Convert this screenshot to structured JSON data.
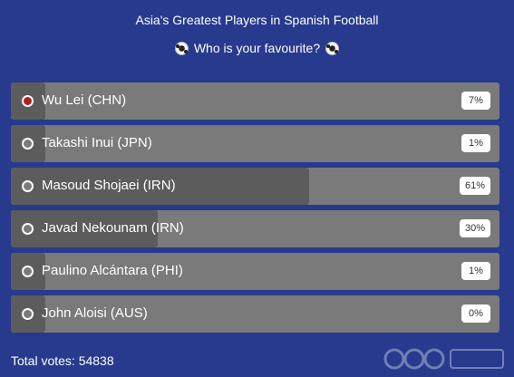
{
  "poll": {
    "title": "Asia's Greatest Players in Spanish Football",
    "subtitle": "Who is your favourite?",
    "options": [
      {
        "label": "Wu Lei (CHN)",
        "percent": "7%",
        "fraction": 0.07,
        "selected": true
      },
      {
        "label": "Takashi Inui (JPN)",
        "percent": "1%",
        "fraction": 0.01,
        "selected": false
      },
      {
        "label": "Masoud Shojaei (IRN)",
        "percent": "61%",
        "fraction": 0.61,
        "selected": false
      },
      {
        "label": "Javad Nekounam (IRN)",
        "percent": "30%",
        "fraction": 0.3,
        "selected": false
      },
      {
        "label": "Paulino Alcántara (PHI)",
        "percent": "1%",
        "fraction": 0.01,
        "selected": false
      },
      {
        "label": "John Aloisi (AUS)",
        "percent": "0%",
        "fraction": 0.0,
        "selected": false
      }
    ],
    "total_votes": "Total votes: 54838"
  },
  "icons": {
    "ball": "soccer-ball-icon",
    "radio": "radio-icon"
  },
  "colors": {
    "background": "#273a8e",
    "bar": "#7a7a7a",
    "fill": "#5c5c5c",
    "selected": "#b11f1f"
  }
}
